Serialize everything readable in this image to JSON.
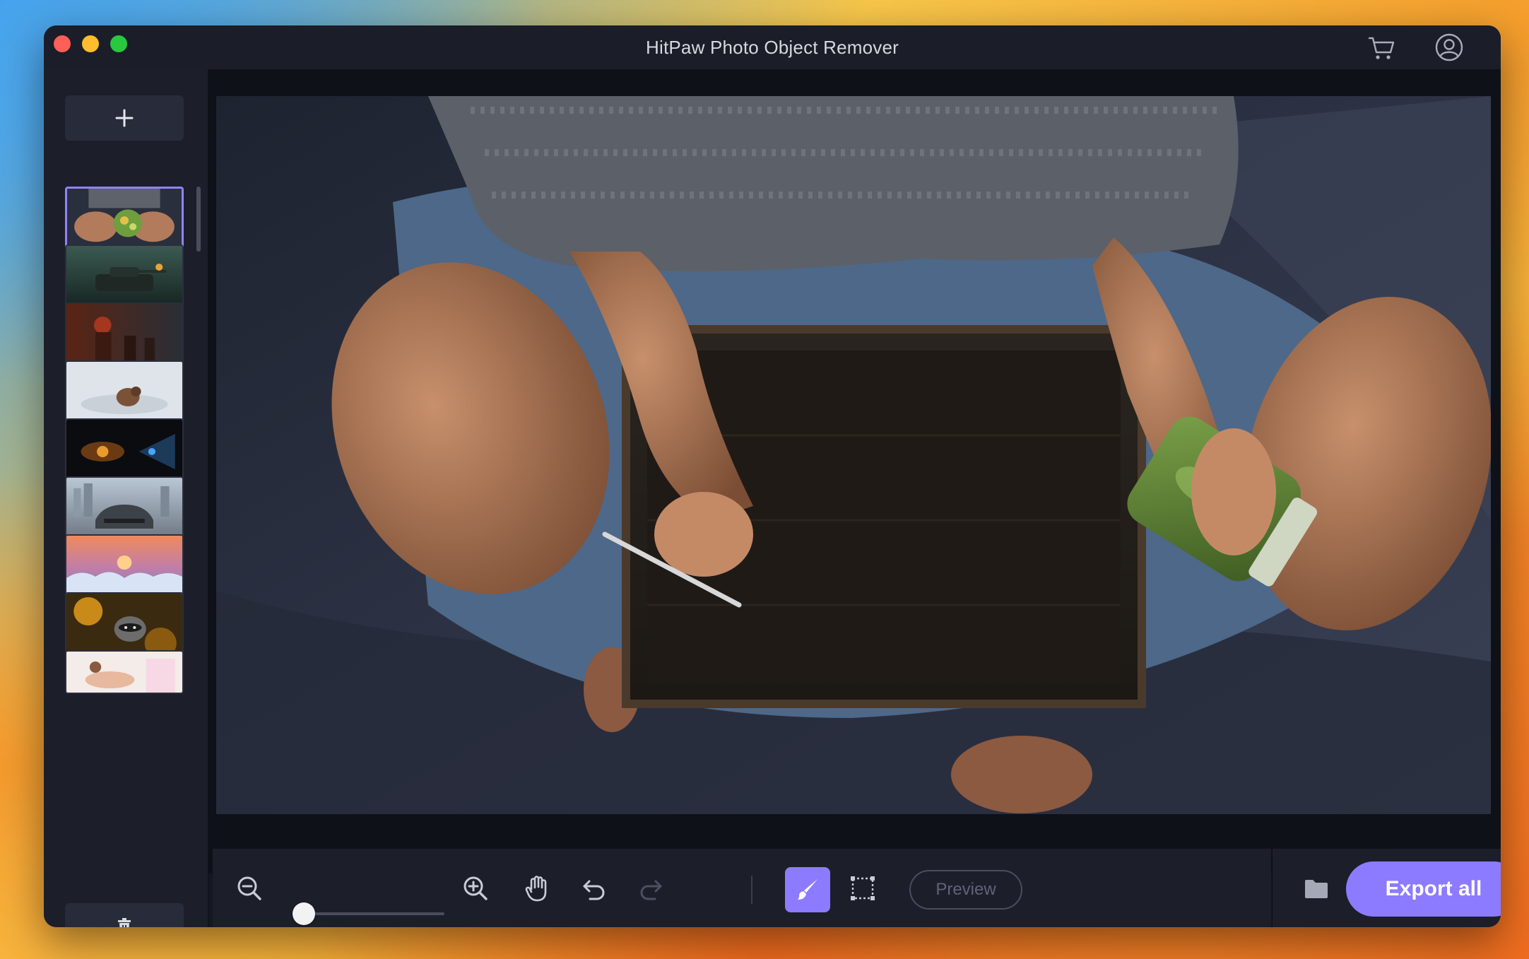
{
  "window": {
    "title": "HitPaw Photo Object Remover"
  },
  "titlebar": {
    "cart_icon": "shopping-cart",
    "account_icon": "user-circle"
  },
  "sidebar": {
    "add_icon": "plus",
    "delete_icon": "trash",
    "thumbnails": [
      {
        "subject": "hands holding smoothie bowl",
        "selected": true
      },
      {
        "subject": "tank in foggy forest",
        "selected": false
      },
      {
        "subject": "soldiers in fiery smoke",
        "selected": false
      },
      {
        "subject": "animal running through snow",
        "selected": false
      },
      {
        "subject": "futuristic glowing ship",
        "selected": false
      },
      {
        "subject": "sports car in city",
        "selected": false
      },
      {
        "subject": "snowy sunset landscape",
        "selected": false
      },
      {
        "subject": "raccoon in leaves",
        "selected": false
      },
      {
        "subject": "person on bright bed",
        "selected": false
      }
    ]
  },
  "toolbar": {
    "zoom_out_icon": "zoom-out",
    "zoom_in_icon": "zoom-in",
    "zoom_level": 0.05,
    "hand_icon": "hand",
    "undo_icon": "undo",
    "redo_icon": "redo",
    "brush_icon": "brush",
    "rect_select_icon": "rectangle-select",
    "preview_label": "Preview",
    "folder_icon": "folder",
    "export_label": "Export all"
  },
  "colors": {
    "accent": "#8c7bff",
    "window_bg": "#151722",
    "panel_bg": "#1c1e2a"
  }
}
